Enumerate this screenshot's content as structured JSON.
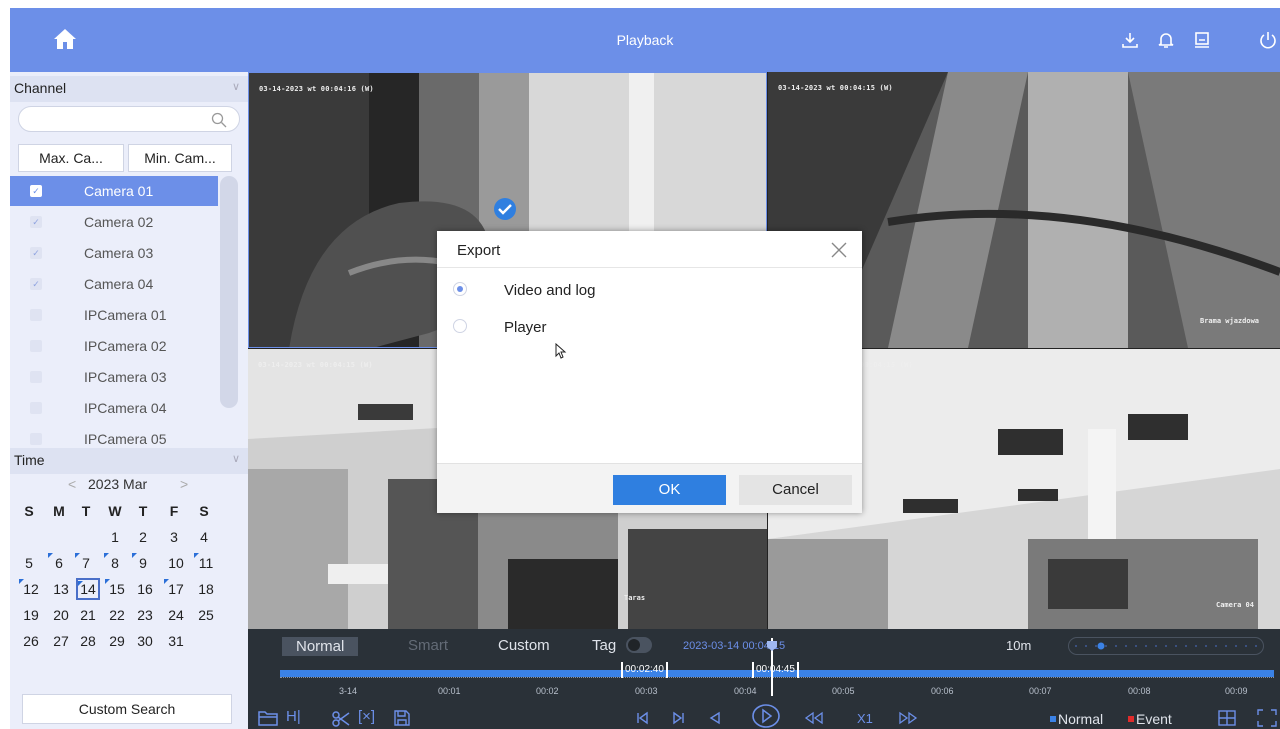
{
  "header": {
    "title": "Playback"
  },
  "left_panel": {
    "channel_heading": "Channel",
    "max_camera_btn": "Max. Ca...",
    "min_camera_btn": "Min. Cam...",
    "cameras": [
      {
        "label": "Camera 01",
        "checked": true,
        "selected": true
      },
      {
        "label": "Camera 02",
        "checked": true
      },
      {
        "label": "Camera 03",
        "checked": true
      },
      {
        "label": "Camera 04",
        "checked": true
      },
      {
        "label": "IPCamera 01",
        "checked": false
      },
      {
        "label": "IPCamera 02",
        "checked": false
      },
      {
        "label": "IPCamera 03",
        "checked": false
      },
      {
        "label": "IPCamera 04",
        "checked": false
      },
      {
        "label": "IPCamera 05",
        "checked": false
      }
    ],
    "time_heading": "Time",
    "calendar": {
      "month_label": "2023 Mar",
      "prev": "<",
      "next": ">",
      "weekdays": [
        "S",
        "M",
        "T",
        "W",
        "T",
        "F",
        "S"
      ],
      "first_weekday": 3,
      "days_in_month": 31,
      "marked_days": [
        6,
        7,
        8,
        9,
        11,
        12,
        14,
        15,
        17
      ],
      "selected_day": 14
    },
    "custom_search_btn": "Custom Search"
  },
  "video": {
    "panes": [
      {
        "timestamp": "03-14-2023 wt 00:04:16 (W)",
        "label": ""
      },
      {
        "timestamp": "03-14-2023 wt 00:04:15 (W)",
        "label": "Brama wjazdowa"
      },
      {
        "timestamp": "03-14-2023 wt 00:04:15 (W)",
        "label": "Taras"
      },
      {
        "timestamp": "00:04:15 (W)",
        "label": "Camera 04"
      }
    ]
  },
  "export_dialog": {
    "title": "Export",
    "options": [
      {
        "label": "Video and log",
        "selected": true
      },
      {
        "label": "Player",
        "selected": false
      }
    ],
    "ok": "OK",
    "cancel": "Cancel"
  },
  "playback": {
    "modes": {
      "normal": "Normal",
      "smart": "Smart",
      "custom": "Custom",
      "tag": "Tag"
    },
    "current_time": "2023-03-14 00:04:15",
    "zoom": "10m",
    "clip_start": "00:02:40",
    "clip_end": "00:04:45",
    "timeline_labels": [
      "3-14",
      "00:01",
      "00:02",
      "00:03",
      "00:04",
      "00:05",
      "00:06",
      "00:07",
      "00:08",
      "00:09"
    ],
    "legend_normal": "Normal",
    "legend_event": "Event",
    "normal_color": "#3b82e6",
    "event_color": "#e02b2b"
  }
}
